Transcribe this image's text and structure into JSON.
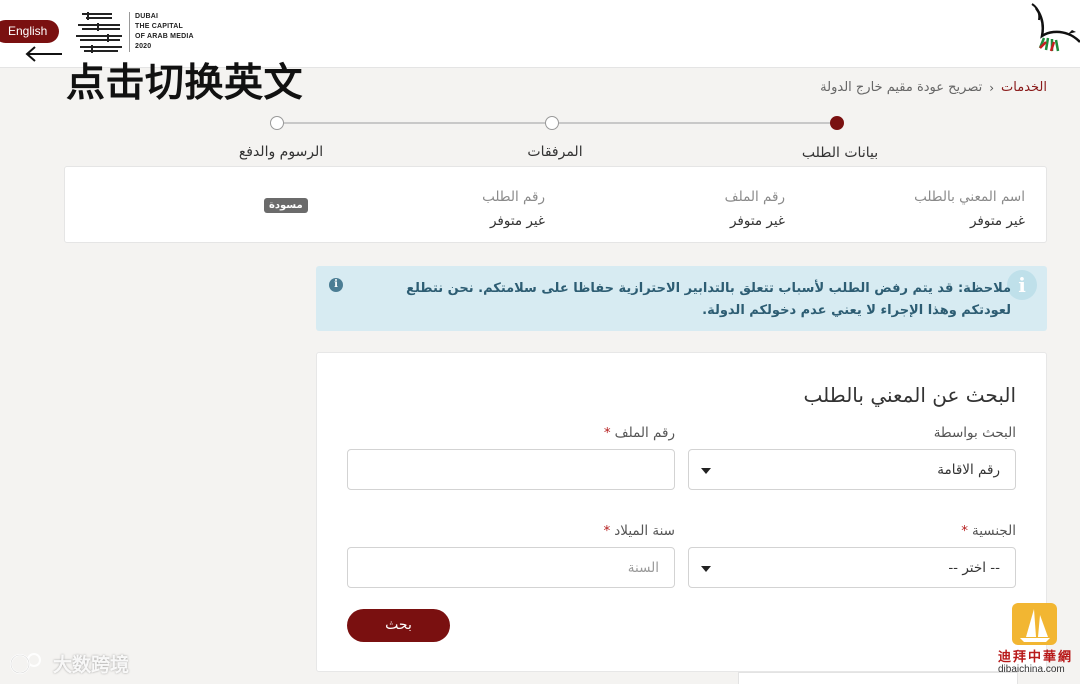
{
  "header": {
    "language_button": "English",
    "logo_en_lines": [
      "DUBAI",
      "THE CAPITAL",
      "OF ARAB MEDIA",
      "2020"
    ],
    "logo_ar_text": "دبي عاصمة الإعلام العربي"
  },
  "annotation": {
    "text": "点击切换英文"
  },
  "breadcrumb": {
    "root": "الخدمات",
    "current": "تصريح عودة مقيم خارج الدولة"
  },
  "stepper": {
    "steps": [
      {
        "label": "بيانات الطلب",
        "state": "active"
      },
      {
        "label": "المرفقات",
        "state": "pending"
      },
      {
        "label": "الرسوم والدفع",
        "state": "pending"
      }
    ]
  },
  "info_card": {
    "badge": "مسودة",
    "fields": [
      {
        "label": "اسم المعني بالطلب",
        "value": "غير متوفر"
      },
      {
        "label": "رقم الملف",
        "value": "غير متوفر"
      },
      {
        "label": "رقم الطلب",
        "value": "غير متوفر"
      }
    ]
  },
  "notice": {
    "text": "ملاحظة: قد يتم رفض الطلب لأسباب تتعلق بالتدابير الاحترازية حفاظا على سلامتكم. نحن نتطلع لعودتكم وهذا الإجراء لا يعني عدم دخولكم الدولة."
  },
  "search_form": {
    "title": "البحث عن المعني بالطلب",
    "search_by_label": "البحث بواسطة",
    "search_by_value": "رقم الاقامة",
    "file_number_label": "رقم الملف",
    "file_number_value": "",
    "nationality_label": "الجنسية",
    "nationality_value": "-- اختر --",
    "birth_year_label": "سنة الميلاد",
    "birth_year_placeholder": "السنة",
    "required_mark": "*",
    "submit_label": "بحث"
  },
  "watermarks": {
    "left": "大数跨境",
    "right_cn": "迪拜中華網",
    "right_url": "dibaichina.com"
  },
  "colors": {
    "brand": "#7a1010",
    "notice_bg": "#d7ebf2",
    "notice_text": "#2d5d73",
    "required": "#b51d1d"
  }
}
